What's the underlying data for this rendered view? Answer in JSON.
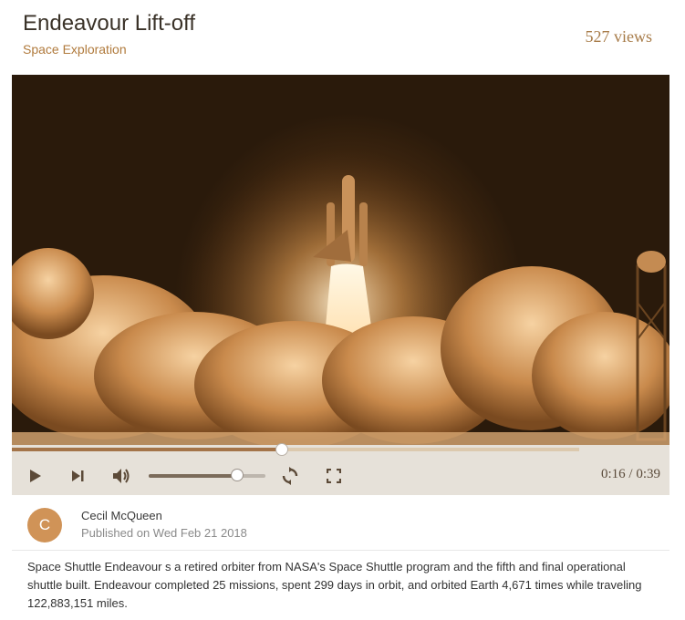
{
  "header": {
    "title": "Endeavour Lift-off",
    "category": "Space Exploration",
    "views": "527 views"
  },
  "player": {
    "progress_fraction": 0.41,
    "volume_fraction": 0.76,
    "time_display": "0:16 / 0:39",
    "controls": [
      "play-icon",
      "skip-next-icon",
      "volume-icon",
      "replay-icon",
      "fullscreen-icon"
    ],
    "accent_color": "#a47449"
  },
  "author": {
    "initial": "C",
    "name": "Cecil McQueen",
    "published": "Published on Wed Feb 21 2018",
    "avatar_color": "#d09357"
  },
  "description": "Space Shuttle Endeavour s a retired orbiter from NASA's Space Shuttle program and the fifth and final operational shuttle built. Endeavour completed 25 missions, spent 299 days in orbit, and orbited Earth 4,671 times while traveling 122,883,151 miles."
}
